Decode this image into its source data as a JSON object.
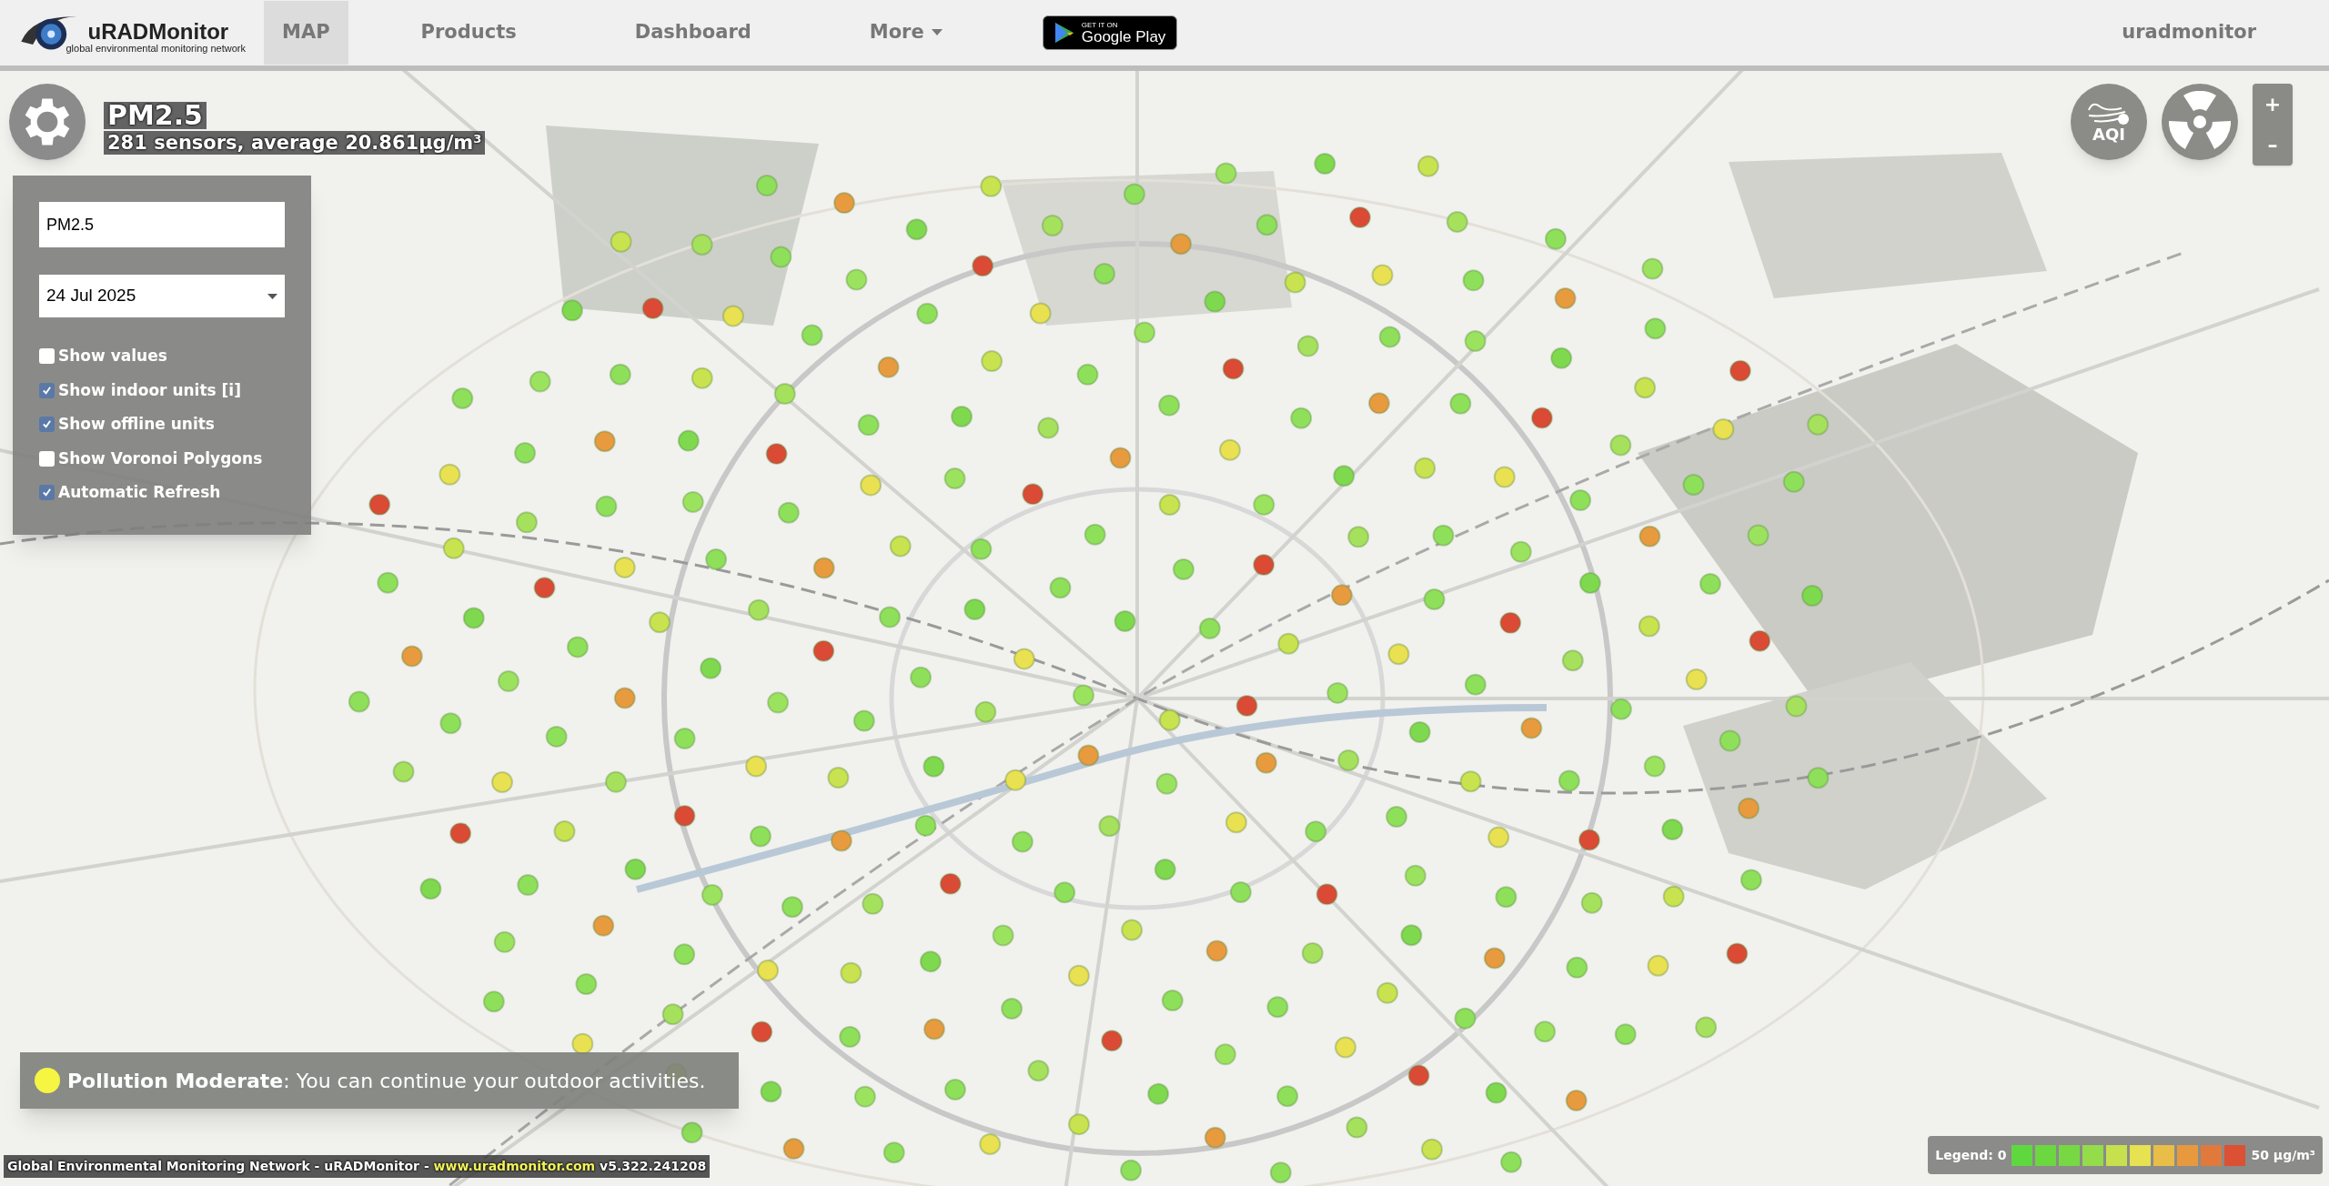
{
  "header": {
    "logo_name": "uRADMonitor",
    "logo_tagline": "global environmental monitoring network",
    "nav": [
      {
        "label": "MAP",
        "selected": true,
        "dropdown": false
      },
      {
        "label": "Products",
        "selected": false,
        "dropdown": false
      },
      {
        "label": "Dashboard",
        "selected": false,
        "dropdown": false
      },
      {
        "label": "More",
        "selected": false,
        "dropdown": true
      }
    ],
    "store_badge": {
      "small": "GET IT ON",
      "big": "Google Play"
    },
    "user": "uradmonitor"
  },
  "overview": {
    "title": "PM2.5",
    "subtitle": "281 sensors, average 20.861µg/m³"
  },
  "settings": {
    "parameter": "PM2.5",
    "date": "24 Jul 2025",
    "options": [
      {
        "label": "Show values",
        "checked": false
      },
      {
        "label": "Show indoor units [i]",
        "checked": true
      },
      {
        "label": "Show offline units",
        "checked": true
      },
      {
        "label": "Show Voronoi Polygons",
        "checked": false
      },
      {
        "label": "Automatic Refresh",
        "checked": true
      }
    ]
  },
  "map_buttons": {
    "aqi": "AQI",
    "zoom_in": "+",
    "zoom_out": "–"
  },
  "banner": {
    "color": "#f5f542",
    "level": "Pollution Moderate",
    "message": ": You can continue your outdoor activities."
  },
  "footer": {
    "prefix": "Global Environmental Monitoring Network - uRADMonitor - ",
    "link": "www.uradmonitor.com",
    "version": " v5.322.241208"
  },
  "legend": {
    "label": "Legend: 0",
    "unit": "50 µg/m³",
    "swatches": [
      {
        "color": "#5fd83f"
      },
      {
        "color": "#6bd840"
      },
      {
        "color": "#78d843"
      },
      {
        "color": "#94dc4a"
      },
      {
        "color": "#c6e04e"
      },
      {
        "color": "#e6e251"
      },
      {
        "color": "#e8bd48"
      },
      {
        "color": "#e8993e"
      },
      {
        "color": "#e07a3c"
      },
      {
        "color": "#dc5034"
      }
    ]
  }
}
